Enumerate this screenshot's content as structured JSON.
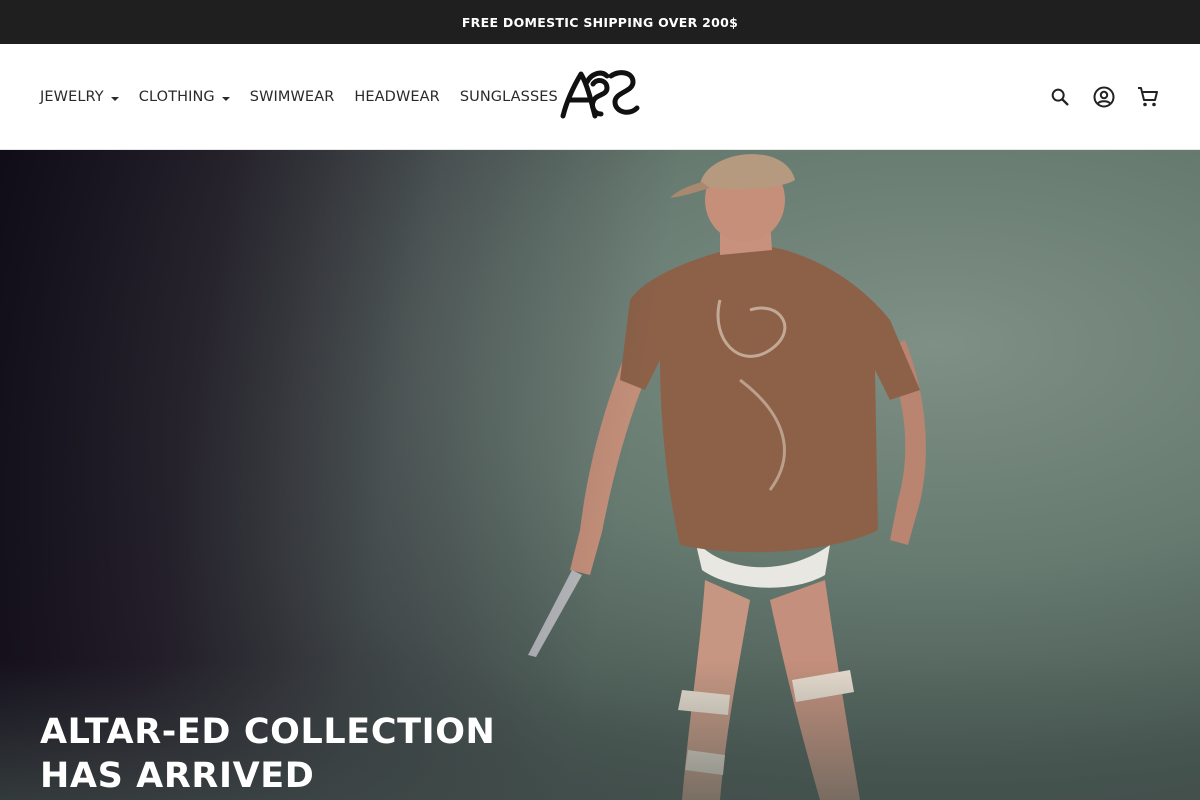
{
  "announcement": {
    "text": "FREE DOMESTIC SHIPPING OVER 200$"
  },
  "nav": {
    "items": [
      {
        "label": "JEWELRY",
        "has_dropdown": true
      },
      {
        "label": "CLOTHING",
        "has_dropdown": true
      },
      {
        "label": "SWIMWEAR",
        "has_dropdown": false
      },
      {
        "label": "HEADWEAR",
        "has_dropdown": false
      },
      {
        "label": "SUNGLASSES",
        "has_dropdown": false
      }
    ]
  },
  "logo": {
    "icon": "brand-monogram-logo"
  },
  "header_icons": [
    "search-icon",
    "account-icon",
    "cart-icon"
  ],
  "hero": {
    "title_line1": "ALTAR-ED COLLECTION",
    "title_line2": "HAS ARRIVED"
  },
  "colors": {
    "announcement_bg": "#1f1f1f",
    "header_bg": "#ffffff",
    "text_dark": "#2a2a2a",
    "hero_text": "#ffffff"
  }
}
